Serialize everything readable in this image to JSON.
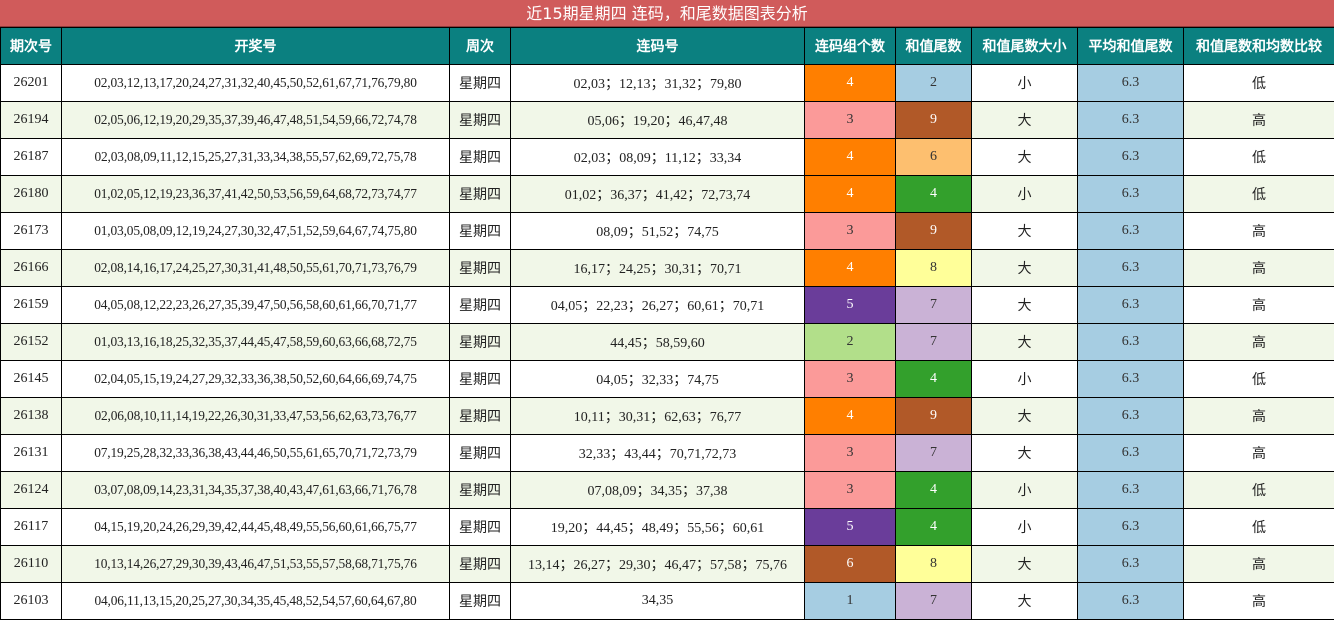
{
  "title": "近15期星期四 连码，和尾数据图表分析",
  "headers": [
    "期次号",
    "开奖号",
    "周次",
    "连码号",
    "连码组个数",
    "和值尾数",
    "和值尾数大小",
    "平均和值尾数",
    "和值尾数和均数比较"
  ],
  "colors": {
    "title_bg": "#d05b5b",
    "header_bg": "#0b8080",
    "row_alt_bg": "#f1f7e8",
    "avg_bg": "#a6cde2",
    "count_colors": {
      "1": "#a6cde2",
      "2": "#b2df8a",
      "3": "#fb9a99",
      "4": "#ff7f00",
      "5": "#6a3d9a",
      "6": "#b15928"
    },
    "tail_colors": {
      "2": "#a6cde2",
      "4": "#33a02c",
      "6": "#fdbf6f",
      "7": "#cab2d6",
      "8": "#ffff99",
      "9": "#b15928"
    }
  },
  "chart_data": {
    "type": "table",
    "title": "近15期星期四 连码，和尾数据图表分析",
    "columns": [
      "期次号",
      "开奖号",
      "周次",
      "连码号",
      "连码组个数",
      "和值尾数",
      "和值尾数大小",
      "平均和值尾数",
      "和值尾数和均数比较"
    ],
    "rows": [
      [
        "26201",
        "02,03,12,13,17,20,24,27,31,32,40,45,50,52,61,67,71,76,79,80",
        "星期四",
        "02,03；12,13；31,32；79,80",
        "4",
        "2",
        "小",
        "6.3",
        "低"
      ],
      [
        "26194",
        "02,05,06,12,19,20,29,35,37,39,46,47,48,51,54,59,66,72,74,78",
        "星期四",
        "05,06；19,20；46,47,48",
        "3",
        "9",
        "大",
        "6.3",
        "高"
      ],
      [
        "26187",
        "02,03,08,09,11,12,15,25,27,31,33,34,38,55,57,62,69,72,75,78",
        "星期四",
        "02,03；08,09；11,12；33,34",
        "4",
        "6",
        "大",
        "6.3",
        "低"
      ],
      [
        "26180",
        "01,02,05,12,19,23,36,37,41,42,50,53,56,59,64,68,72,73,74,77",
        "星期四",
        "01,02；36,37；41,42；72,73,74",
        "4",
        "4",
        "小",
        "6.3",
        "低"
      ],
      [
        "26173",
        "01,03,05,08,09,12,19,24,27,30,32,47,51,52,59,64,67,74,75,80",
        "星期四",
        "08,09；51,52；74,75",
        "3",
        "9",
        "大",
        "6.3",
        "高"
      ],
      [
        "26166",
        "02,08,14,16,17,24,25,27,30,31,41,48,50,55,61,70,71,73,76,79",
        "星期四",
        "16,17；24,25；30,31；70,71",
        "4",
        "8",
        "大",
        "6.3",
        "高"
      ],
      [
        "26159",
        "04,05,08,12,22,23,26,27,35,39,47,50,56,58,60,61,66,70,71,77",
        "星期四",
        "04,05；22,23；26,27；60,61；70,71",
        "5",
        "7",
        "大",
        "6.3",
        "高"
      ],
      [
        "26152",
        "01,03,13,16,18,25,32,35,37,44,45,47,58,59,60,63,66,68,72,75",
        "星期四",
        "44,45；58,59,60",
        "2",
        "7",
        "大",
        "6.3",
        "高"
      ],
      [
        "26145",
        "02,04,05,15,19,24,27,29,32,33,36,38,50,52,60,64,66,69,74,75",
        "星期四",
        "04,05；32,33；74,75",
        "3",
        "4",
        "小",
        "6.3",
        "低"
      ],
      [
        "26138",
        "02,06,08,10,11,14,19,22,26,30,31,33,47,53,56,62,63,73,76,77",
        "星期四",
        "10,11；30,31；62,63；76,77",
        "4",
        "9",
        "大",
        "6.3",
        "高"
      ],
      [
        "26131",
        "07,19,25,28,32,33,36,38,43,44,46,50,55,61,65,70,71,72,73,79",
        "星期四",
        "32,33；43,44；70,71,72,73",
        "3",
        "7",
        "大",
        "6.3",
        "高"
      ],
      [
        "26124",
        "03,07,08,09,14,23,31,34,35,37,38,40,43,47,61,63,66,71,76,78",
        "星期四",
        "07,08,09；34,35；37,38",
        "3",
        "4",
        "小",
        "6.3",
        "低"
      ],
      [
        "26117",
        "04,15,19,20,24,26,29,39,42,44,45,48,49,55,56,60,61,66,75,77",
        "星期四",
        "19,20；44,45；48,49；55,56；60,61",
        "5",
        "4",
        "小",
        "6.3",
        "低"
      ],
      [
        "26110",
        "10,13,14,26,27,29,30,39,43,46,47,51,53,55,57,58,68,71,75,76",
        "星期四",
        "13,14；26,27；29,30；46,47；57,58；75,76",
        "6",
        "8",
        "大",
        "6.3",
        "高"
      ],
      [
        "26103",
        "04,06,11,13,15,20,25,27,30,34,35,45,48,52,54,57,60,64,67,80",
        "星期四",
        "34,35",
        "1",
        "7",
        "大",
        "6.3",
        "高"
      ]
    ]
  }
}
